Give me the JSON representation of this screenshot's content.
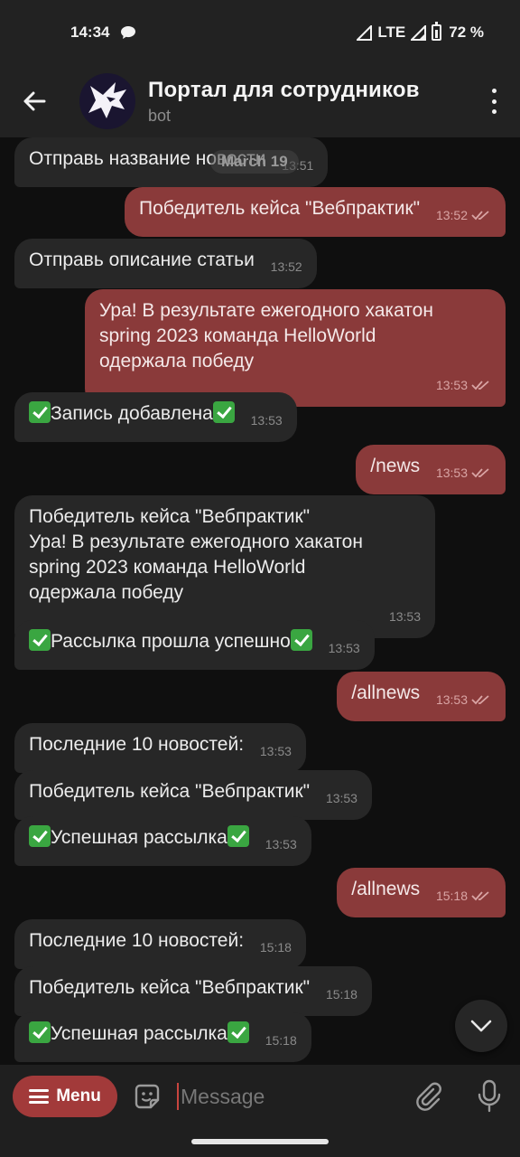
{
  "status": {
    "time": "14:34",
    "network": "LTE",
    "battery": "72 %"
  },
  "header": {
    "title": "Портал для сотрудников",
    "subtitle": "bot"
  },
  "date_chip": "March 19",
  "messages": [
    {
      "text": "Отправь название новости",
      "time": "13:51"
    },
    {
      "text": "Победитель кейса \"Вебпрактик\"",
      "time": "13:52"
    },
    {
      "text": "Отправь описание статьи",
      "time": "13:52"
    },
    {
      "text": "Ура! В результате ежегодного хакатон\nspring 2023 команда HelloWorld\nодержала победу",
      "time": "13:53"
    },
    {
      "text": "Запись добавлена",
      "time": "13:53"
    },
    {
      "text": "/news",
      "time": "13:53"
    },
    {
      "text": "Победитель кейса \"Вебпрактик\"\nУра! В результате ежегодного хакатон\nspring 2023 команда HelloWorld\nодержала победу",
      "time": "13:53"
    },
    {
      "text": "Рассылка прошла успешно",
      "time": "13:53"
    },
    {
      "text": "/allnews",
      "time": "13:53"
    },
    {
      "text": "Последние 10 новостей:",
      "time": "13:53"
    },
    {
      "text": "Победитель кейса \"Вебпрактик\"",
      "time": "13:53"
    },
    {
      "text": "Успешная рассылка",
      "time": "13:53"
    },
    {
      "text": "/allnews",
      "time": "15:18"
    },
    {
      "text": "Последние 10 новостей:",
      "time": "15:18"
    },
    {
      "text": "Победитель кейса \"Вебпрактик\"",
      "time": "15:18"
    },
    {
      "text": "Успешная рассылка",
      "time": "15:18"
    }
  ],
  "input": {
    "menu_label": "Menu",
    "placeholder": "Message"
  },
  "colors": {
    "accent": "#a23a3a",
    "outgoing_bubble": "#8a3a3a",
    "incoming_bubble": "#272727",
    "emoji_check": "#3aa641"
  },
  "icons": [
    "back-arrow-icon",
    "more-vertical-icon",
    "chat-bubble-icon",
    "signal-icon",
    "battery-icon",
    "double-check-icon",
    "check-mark-emoji-icon",
    "chevron-down-icon",
    "sticker-icon",
    "paperclip-icon",
    "microphone-icon",
    "menu-burger-icon"
  ]
}
